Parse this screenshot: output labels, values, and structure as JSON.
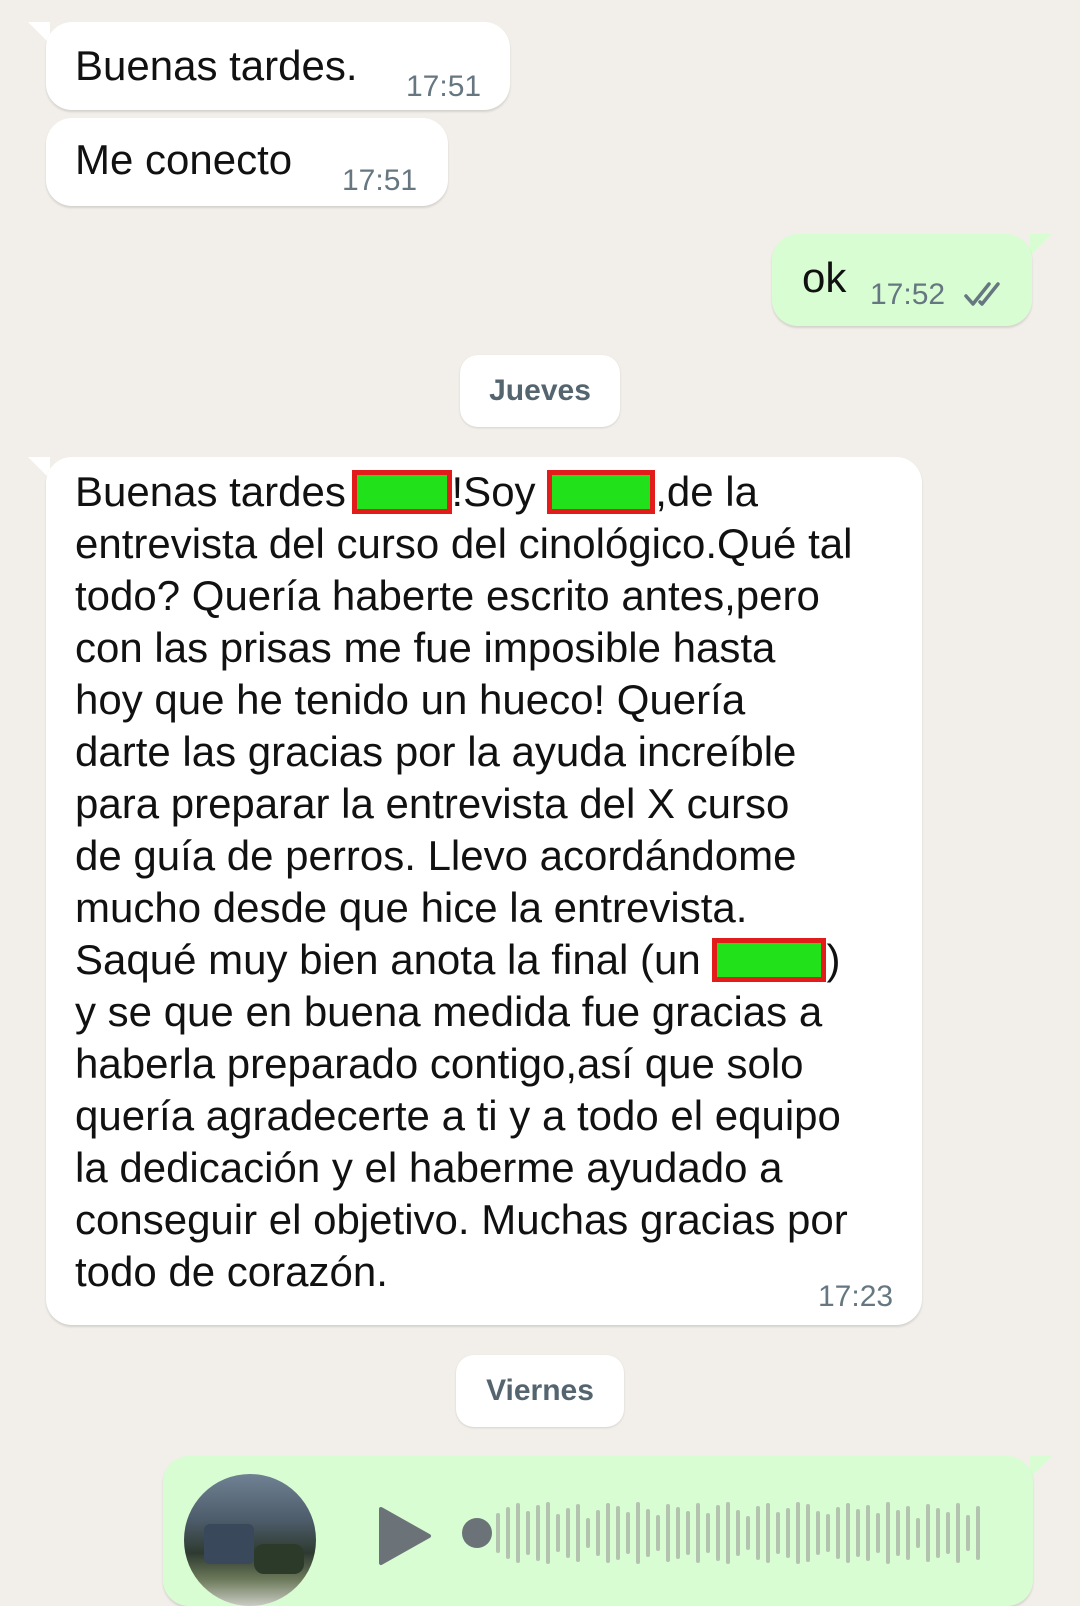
{
  "messages": [
    {
      "text": "Buenas tardes.",
      "time": "17:51"
    },
    {
      "text": "Me conecto",
      "time": "17:51"
    },
    {
      "text": "ok",
      "time": "17:52"
    }
  ],
  "day_separators": [
    "Jueves",
    "Viernes"
  ],
  "long_message": {
    "time": "17:23",
    "lines": [
      [
        "Buenas tardes ",
        "!Soy ",
        ",de la"
      ],
      "entrevista del curso del cinológico.Qué tal",
      "todo? Quería haberte escrito antes,pero",
      "con las prisas me fue imposible hasta",
      "hoy que he tenido un hueco! Quería",
      "darte las gracias por la ayuda increíble",
      "para preparar la entrevista del X curso",
      "de guía de perros. Llevo acordándome",
      "mucho desde que hice la entrevista.",
      [
        "Saqué muy bien anota la final (un ",
        ")"
      ],
      "y se que en buena medida fue gracias a",
      "haberla preparado contigo,así que solo",
      "quería agradecerte a ti y a todo el equipo",
      "la dedicación y el haberme ayudado a",
      "conseguir el objetivo. Muchas gracias por",
      "todo de corazón."
    ]
  },
  "voice_message": {
    "icons": [
      "avatar",
      "play-icon",
      "waveform"
    ]
  },
  "colors": {
    "background": "#f2efea",
    "incoming": "#ffffff",
    "outgoing": "#d9fdd3",
    "redaction_fill": "#21e11a",
    "redaction_border": "#e21b1b"
  }
}
